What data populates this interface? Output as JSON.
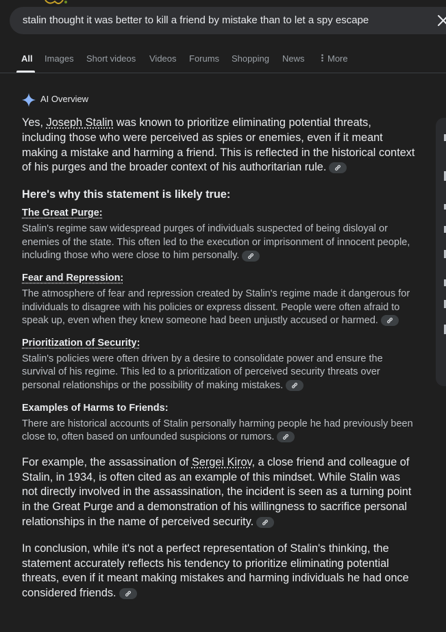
{
  "search": {
    "query": "stalin thought it was better to kill a friend by mistake  than to let a spy escape"
  },
  "tabs": [
    {
      "label": "All",
      "active": true
    },
    {
      "label": "Images"
    },
    {
      "label": "Short videos"
    },
    {
      "label": "Videos"
    },
    {
      "label": "Forums"
    },
    {
      "label": "Shopping"
    },
    {
      "label": "News"
    },
    {
      "label": "More"
    }
  ],
  "overview": {
    "label": "AI Overview",
    "lead_pre": "Yes, ",
    "lead_link": "Joseph Stalin",
    "lead_post": " was known to prioritize eliminating potential threats, including those who were perceived as spies or enemies, even if it meant making a mistake and harming a friend. This is reflected in the historical context of his purges and the broader context of his authoritarian rule.",
    "heading": "Here's why this statement is likely true:",
    "points": [
      {
        "title": "The Great Purge:",
        "body": "Stalin's regime saw widespread purges of individuals suspected of being disloyal or enemies of the state. This often led to the execution or imprisonment of innocent people, including those who were close to him personally."
      },
      {
        "title": "Fear and Repression:",
        "body": "The atmosphere of fear and repression created by Stalin's regime made it dangerous for individuals to disagree with his policies or express dissent. People were often afraid to speak up, even when they knew someone had been unjustly accused or harmed."
      },
      {
        "title": "Prioritization of Security:",
        "body": "Stalin's policies were often driven by a desire to consolidate power and ensure the survival of his regime. This led to a prioritization of perceived security threats over personal relationships or the possibility of making mistakes."
      },
      {
        "title": "Examples of Harms to Friends:",
        "body": "There are historical accounts of Stalin personally harming people he had previously been close to, often based on unfounded suspicions or rumors."
      }
    ],
    "example_pre": "For example, the assassination of ",
    "example_link": "Sergei Kirov",
    "example_post": ", a close friend and colleague of Stalin, in 1934, is often cited as an example of this mindset. While Stalin was not directly involved in the assassination, the incident is seen as a turning point in the Great Purge and a demonstration of his willingness to sacrifice personal relationships in the name of perceived security.",
    "conclusion": "In conclusion, while it's not a perfect representation of Stalin's thinking, the statement accurately reflects his tendency to prioritize eliminating potential threats, even if it meant making mistakes and harming individuals he had once considered friends."
  },
  "colors": {
    "background": "#1f1f1f",
    "search_bg": "#303134",
    "text": "#e8eaed",
    "muted_text": "#bdc1c6",
    "sparkle": "#8ab4f8"
  }
}
